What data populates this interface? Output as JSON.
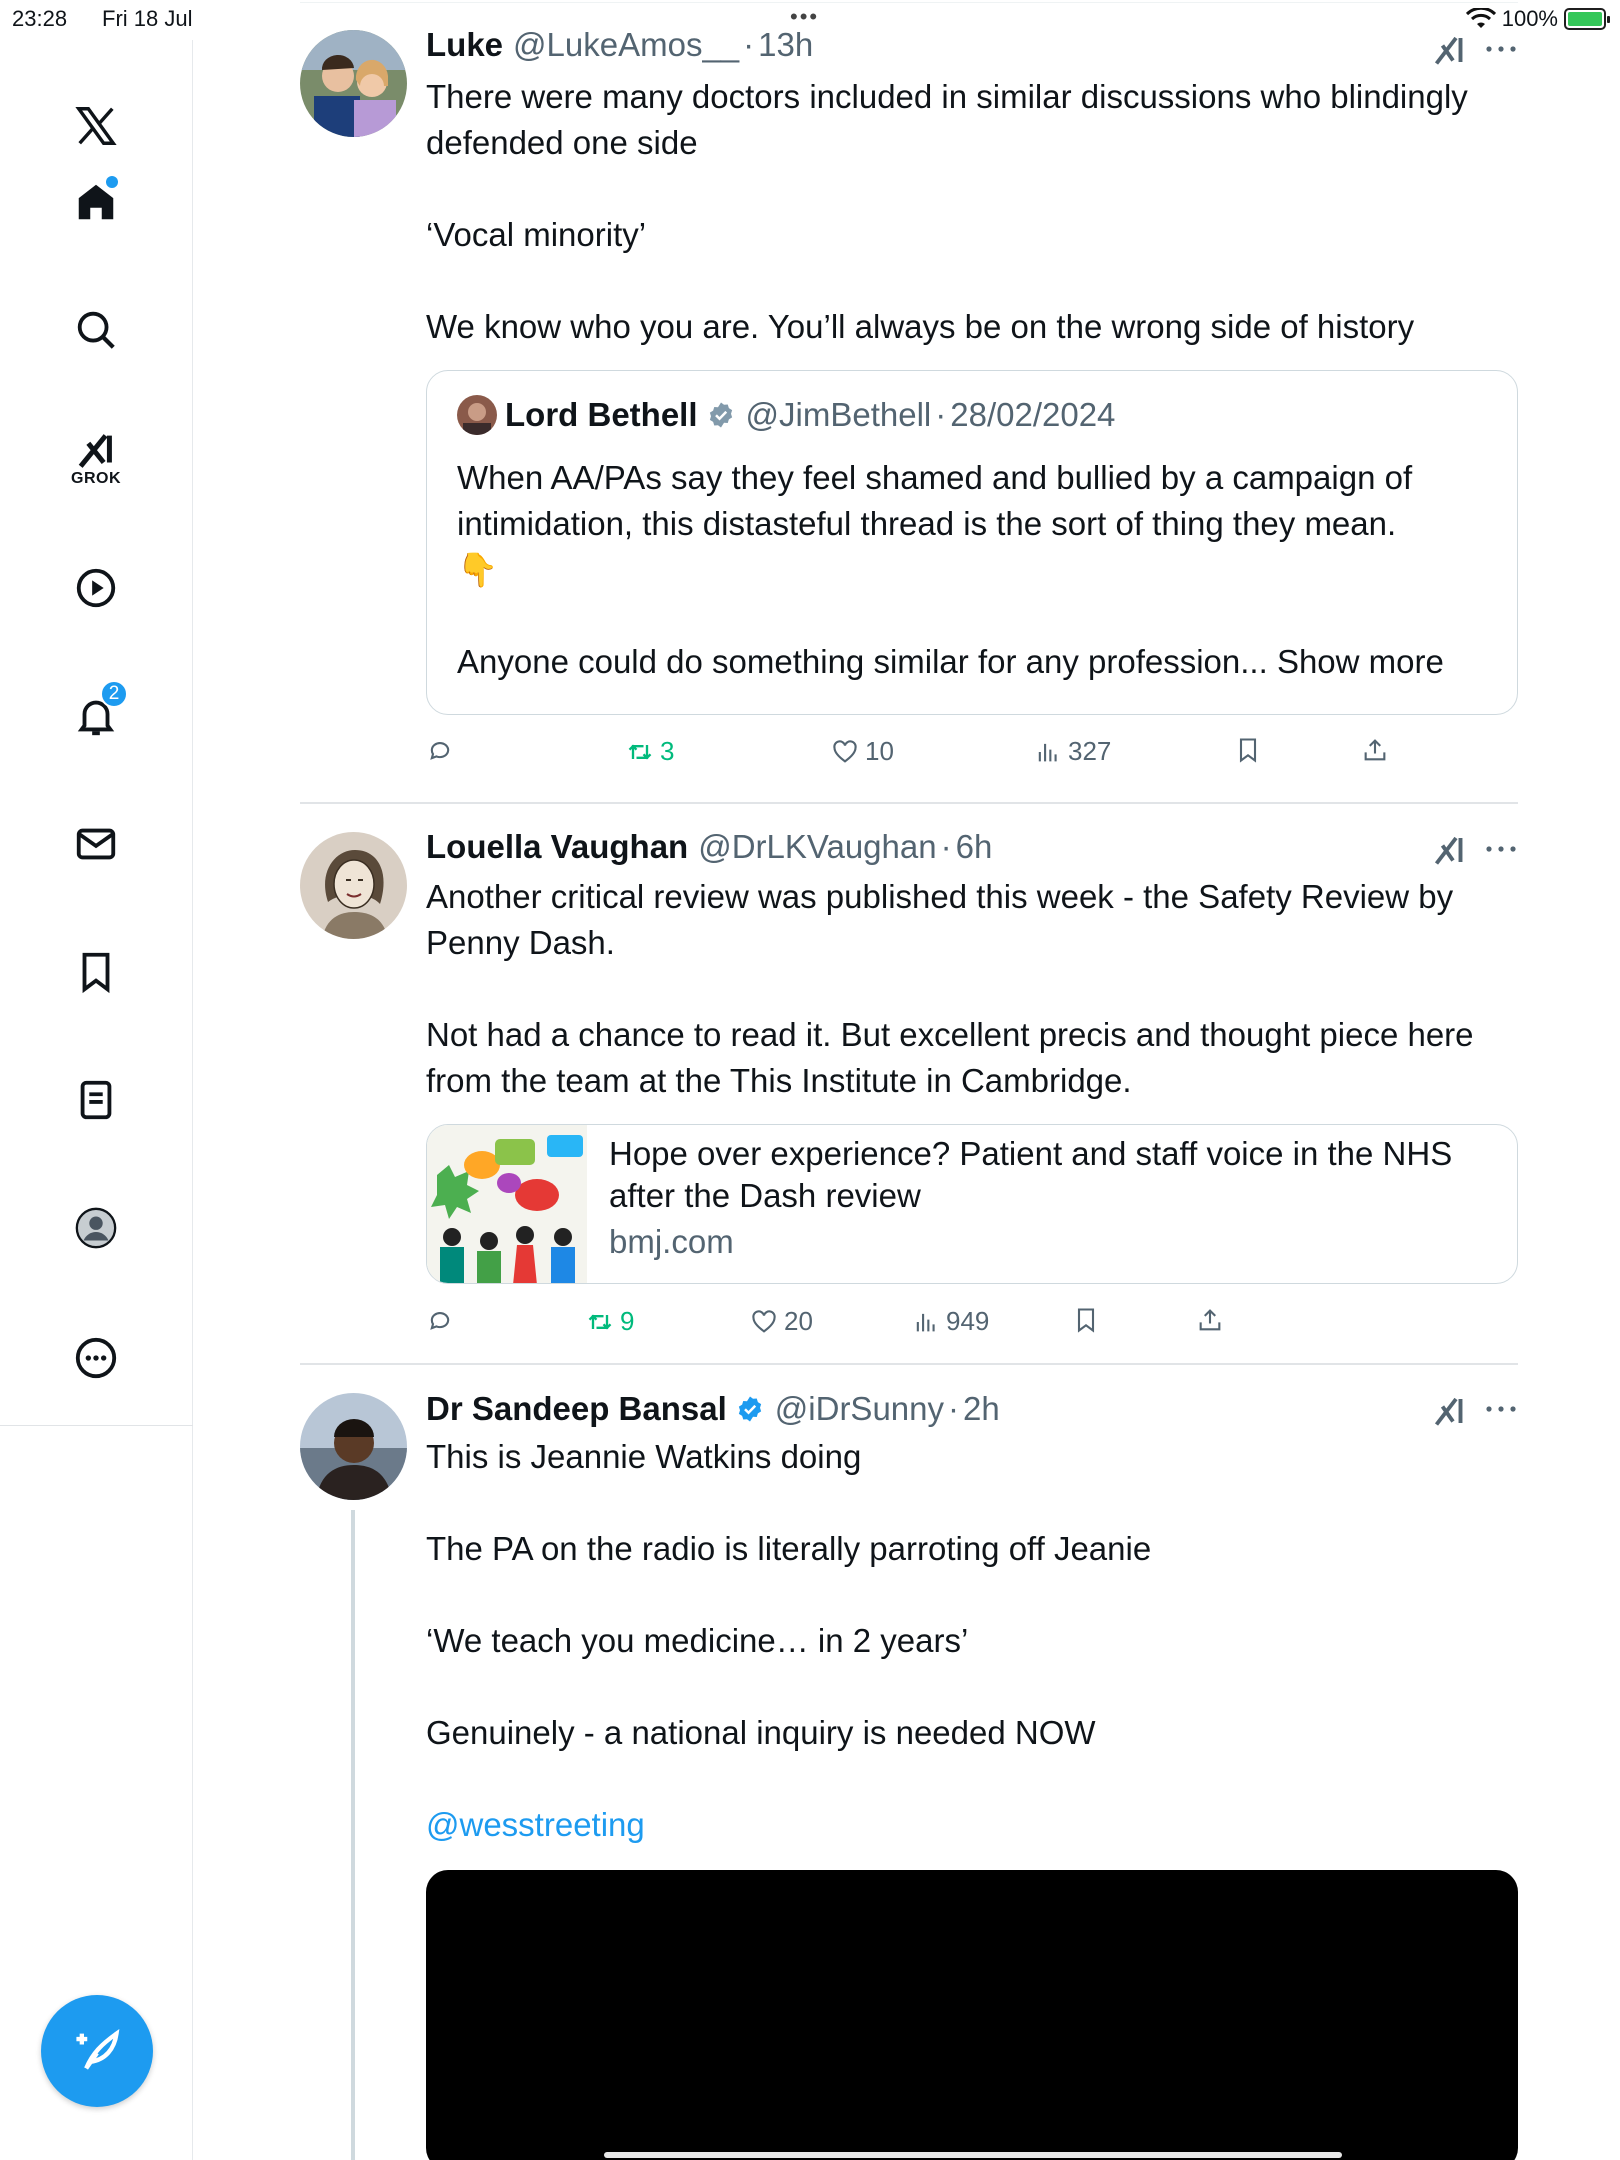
{
  "status_bar": {
    "time": "23:28",
    "date": "Fri 18 Jul",
    "battery": "100%"
  },
  "sidebar": {
    "grok_label": "GROK",
    "notifications_count": "2"
  },
  "tweets": [
    {
      "name": "Luke",
      "handle": "@LukeAmos__",
      "time": "13h",
      "body": [
        "There were many doctors included in similar discussions who blindingly defended one side",
        "‘Vocal minority’",
        "We know who you are. You’ll always be on the wrong side of history"
      ],
      "quote": {
        "name": "Lord Bethell",
        "handle": "@JimBethell",
        "time": "28/02/2024",
        "body": "When AA/PAs say they feel shamed and bullied by a campaign of intimidation, this distasteful thread is the sort of thing they mean.",
        "emoji": "👇",
        "body2": "Anyone could do something similar for any profession...",
        "show_more": "Show more"
      },
      "stats": {
        "retweets": "3",
        "likes": "10",
        "views": "327"
      }
    },
    {
      "name": "Louella Vaughan",
      "handle": "@DrLKVaughan",
      "time": "6h",
      "body": [
        "Another critical review was published this week - the Safety Review by Penny Dash.",
        "Not had a chance to read it. But excellent precis and thought piece here from the team at the This Institute in Cambridge."
      ],
      "card": {
        "title": "Hope over experience? Patient and staff voice in the NHS after the Dash review",
        "domain": "bmj.com"
      },
      "stats": {
        "retweets": "9",
        "likes": "20",
        "views": "949"
      }
    },
    {
      "name": "Dr Sandeep Bansal",
      "handle": "@iDrSunny",
      "time": "2h",
      "body": [
        "This is Jeannie Watkins doing",
        "The PA on the radio is literally parroting off Jeanie",
        "‘We teach you medicine… in 2 years’",
        "Genuinely - a national inquiry is needed NOW"
      ],
      "mention": "@wesstreeting"
    }
  ],
  "separator": "·"
}
